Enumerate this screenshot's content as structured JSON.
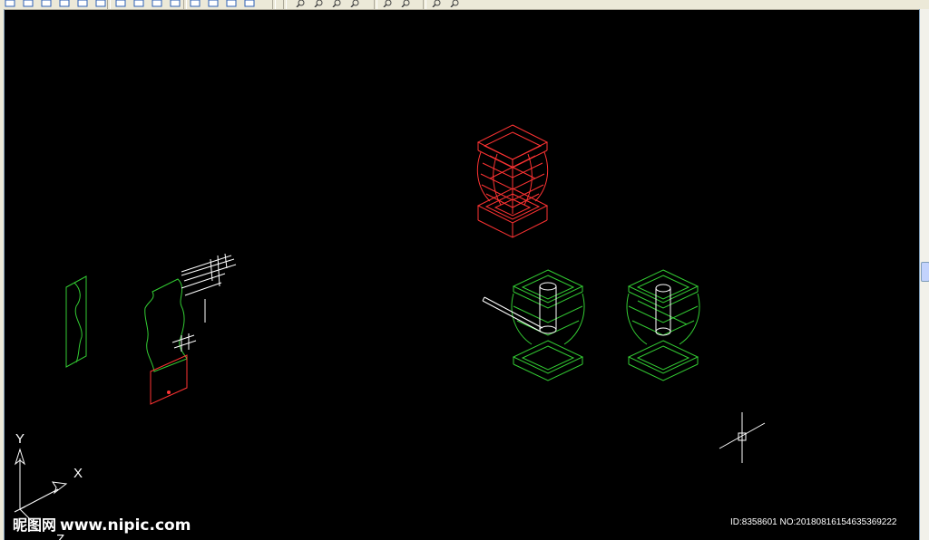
{
  "toolbar": {
    "buttons": [
      {
        "icon": "view-icon"
      },
      {
        "icon": "view-icon"
      },
      {
        "icon": "view-icon"
      },
      {
        "icon": "view-icon"
      },
      {
        "icon": "view-icon"
      },
      {
        "icon": "view-icon"
      },
      {
        "icon": "view-icon"
      },
      {
        "icon": "view-icon"
      },
      {
        "icon": "view-icon"
      },
      {
        "icon": "view-icon"
      },
      {
        "icon": "view-icon"
      },
      {
        "icon": "zoom-icon"
      },
      {
        "icon": "zoom-icon"
      },
      {
        "icon": "zoom-icon"
      },
      {
        "icon": "zoom-icon"
      },
      {
        "icon": "zoom-icon"
      },
      {
        "icon": "zoom-icon"
      },
      {
        "icon": "zoom-icon"
      },
      {
        "icon": "zoom-icon"
      }
    ]
  },
  "canvas": {
    "background": "#000000",
    "colors": {
      "red": "#ff3333",
      "green": "#33cc33",
      "white": "#ffffff"
    }
  },
  "ucs": {
    "y_label": "Y",
    "x_label": "X",
    "z_label": "Z"
  },
  "watermark": {
    "logo_cjk": "昵图网",
    "logo_url": "www.nipic.com",
    "id_text": "ID:8358601 NO:20180816154635369222"
  }
}
